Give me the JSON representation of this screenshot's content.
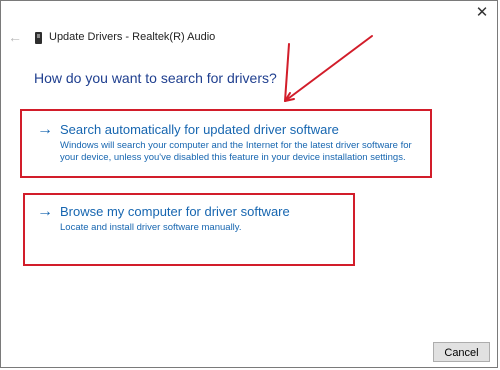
{
  "window": {
    "title": "Update Drivers - Realtek(R) Audio",
    "back_icon": "back-arrow-icon",
    "close_label": "✕"
  },
  "prompt": {
    "question": "How do you want to search for drivers?"
  },
  "options": [
    {
      "arrow": "→",
      "title": "Search automatically for updated driver software",
      "description": "Windows will search your computer and the Internet for the latest driver software for your device, unless you've disabled this feature in your device installation settings."
    },
    {
      "arrow": "→",
      "title": "Browse my computer for driver software",
      "description": "Locate and install driver software manually."
    }
  ],
  "footer": {
    "cancel_label": "Cancel"
  },
  "colors": {
    "link_blue": "#1766b0",
    "heading_blue": "#1f3f8f",
    "annotation_red": "#d21d2a"
  }
}
